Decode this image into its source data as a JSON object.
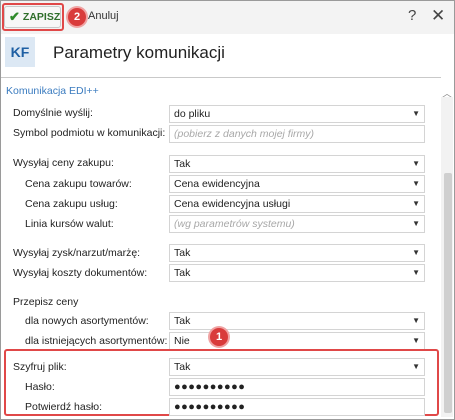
{
  "toolbar": {
    "save_label": "ZAPISZ",
    "cancel_label": "Anuluj",
    "help_label": "?",
    "close_label": "✕",
    "badge_save": "2",
    "badge_field": "1"
  },
  "header": {
    "logo_text": "KF",
    "title": "Parametry komunikacji"
  },
  "section": {
    "title": "Komunikacja EDI++",
    "collapse_glyph": "︿"
  },
  "fields": [
    {
      "label": "Domyślnie wyślij:",
      "value": "do pliku",
      "type": "select"
    },
    {
      "label": "Symbol podmiotu w komunikacji:",
      "value": "(pobierz z danych mojej firmy)",
      "type": "text-placeholder"
    },
    {
      "label": "Wysyłaj ceny zakupu:",
      "value": "Tak",
      "type": "select"
    },
    {
      "label": "Cena zakupu towarów:",
      "value": "Cena ewidencyjna",
      "type": "select"
    },
    {
      "label": "Cena zakupu usług:",
      "value": "Cena ewidencyjna usługi",
      "type": "select"
    },
    {
      "label": "Linia kursów walut:",
      "value": "(wg parametrów systemu)",
      "type": "select-placeholder"
    },
    {
      "label": "Wysyłaj zysk/narzut/marżę:",
      "value": "Tak",
      "type": "select"
    },
    {
      "label": "Wysyłaj koszty dokumentów:",
      "value": "Tak",
      "type": "select"
    },
    {
      "label": "Przepisz ceny",
      "value": null,
      "type": "heading"
    },
    {
      "label": "dla nowych asortymentów:",
      "value": "Tak",
      "type": "select"
    },
    {
      "label": "dla istniejących asortymentów:",
      "value": "Nie",
      "type": "select"
    },
    {
      "label": "Szyfruj plik:",
      "value": "Tak",
      "type": "select"
    },
    {
      "label": "Hasło:",
      "value": "●●●●●●●●●●",
      "type": "password"
    },
    {
      "label": "Potwierdź hasło:",
      "value": "●●●●●●●●●●",
      "type": "password"
    }
  ],
  "icons": {
    "chevron": "chevron-down-icon",
    "check": "checkmark-icon"
  },
  "colors": {
    "accent_blue": "#3a7bbf",
    "highlight_red": "#e04848",
    "save_green": "#2e6e2a"
  }
}
